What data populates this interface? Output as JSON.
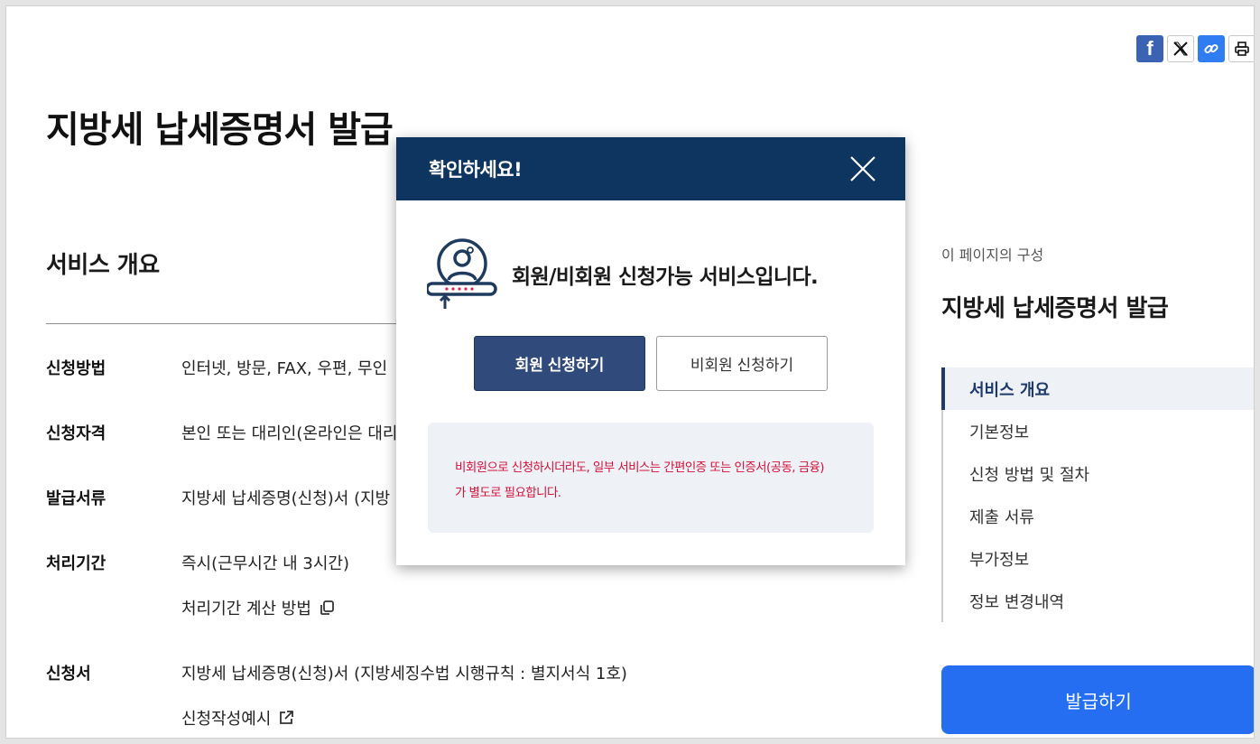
{
  "share": {
    "items": [
      {
        "name": "facebook-icon",
        "label": "f"
      },
      {
        "name": "x-icon",
        "label": "𝕏"
      },
      {
        "name": "link-icon",
        "label": ""
      },
      {
        "name": "print-icon",
        "label": ""
      }
    ]
  },
  "page": {
    "title": "지방세 납세증명서 발급"
  },
  "overview": {
    "title": "서비스 개요",
    "rows": [
      {
        "label": "신청방법",
        "values": [
          "인터넷, 방문, FAX, 우편, 무인"
        ]
      },
      {
        "label": "신청자격",
        "values": [
          "본인 또는 대리인(온라인은 대리"
        ]
      },
      {
        "label": "발급서류",
        "values": [
          "지방세 납세증명(신청)서 (지방"
        ]
      },
      {
        "label": "처리기간",
        "values": [
          "즉시(근무시간 내 3시간)",
          "처리기간 계산 방법"
        ]
      },
      {
        "label": "신청서",
        "values": [
          "지방세 납세증명(신청)서 (지방세징수법 시행규칙 : 별지서식 1호)",
          "신청작성예시"
        ]
      }
    ]
  },
  "toc": {
    "caption": "이 페이지의 구성",
    "title": "지방세 납세증명서 발급",
    "items": [
      "서비스 개요",
      "기본정보",
      "신청 방법 및 절차",
      "제출 서류",
      "부가정보",
      "정보 변경내역"
    ],
    "active_index": 0,
    "issue_button": "발급하기"
  },
  "modal": {
    "title": "확인하세요!",
    "message": "회원/비회원 신청가능 서비스입니다.",
    "member_button": "회원 신청하기",
    "guest_button": "비회원 신청하기",
    "notice_line1": "비회원으로 신청하시더라도, 일부 서비스는 간편인증 또는 인증서(공동, 금융)",
    "notice_line2": "가 별도로 필요합니다."
  },
  "colors": {
    "modal_header": "#0e3460",
    "member_button": "#304a7c",
    "issue_button": "#256ef1",
    "notice_text": "#d2113b",
    "toc_active": "#1d3a6b"
  }
}
